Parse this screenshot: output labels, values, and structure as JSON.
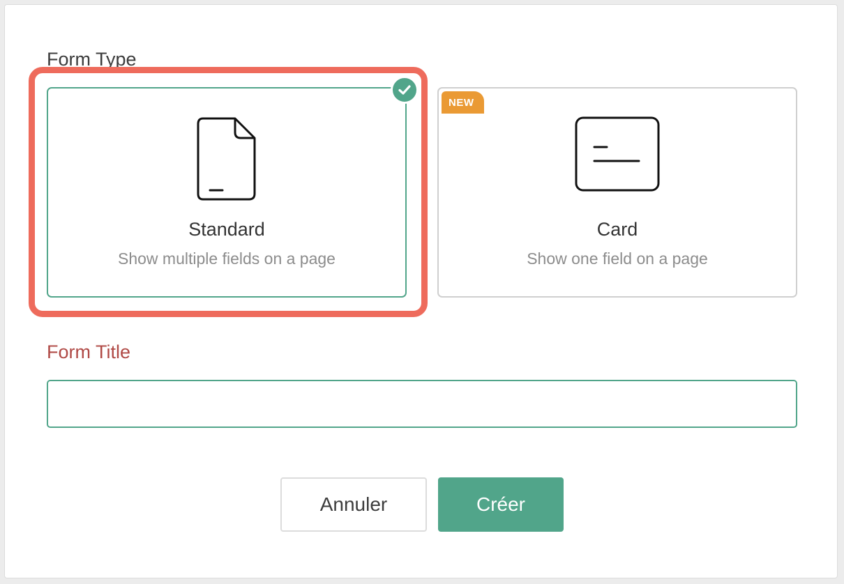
{
  "form_type": {
    "label": "Form Type",
    "options": [
      {
        "name": "Standard",
        "description": "Show multiple fields on a page",
        "icon": "document-icon",
        "selected": true
      },
      {
        "name": "Card",
        "description": "Show one field on a page",
        "icon": "card-icon",
        "selected": false,
        "badge": "NEW"
      }
    ]
  },
  "form_title": {
    "label": "Form Title",
    "value": ""
  },
  "buttons": {
    "cancel": "Annuler",
    "create": "Créer"
  },
  "colors": {
    "accent": "#51a58a",
    "highlight": "#ee6b5c",
    "new_badge": "#ea9a34",
    "error_label": "#b04a46"
  }
}
